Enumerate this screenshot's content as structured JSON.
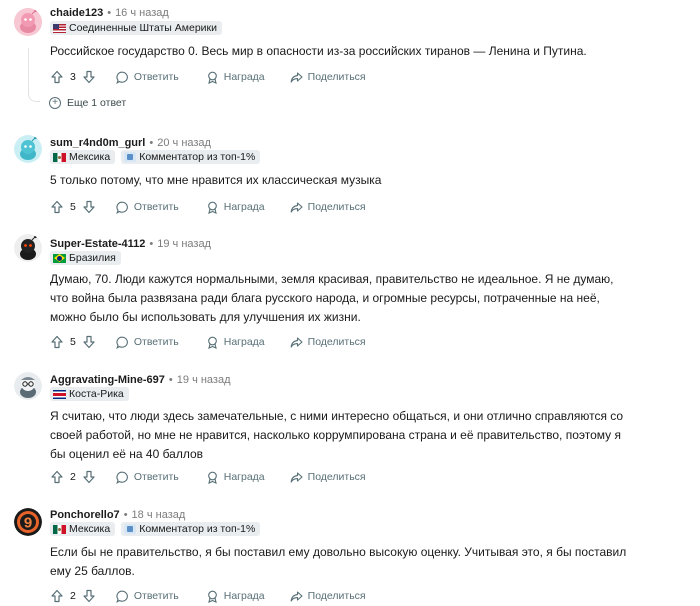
{
  "actions": {
    "reply": "Ответить",
    "award": "Награда",
    "share": "Поделиться"
  },
  "comments": [
    {
      "author": "chaide123",
      "time": "16 ч назад",
      "avatar": "pink-alien-avatar",
      "flairs": [
        {
          "icon": "flag-us-icon",
          "text": "Соединенные Штаты Америки"
        }
      ],
      "body": "Российское государство 0. Весь мир в опасности из-за российских тиранов — Ленина и Путина.",
      "votes": "3",
      "more_replies": "Еще 1 ответ"
    },
    {
      "author": "sum_r4nd0m_gurl",
      "time": "20 ч назад",
      "avatar": "teal-alien-avatar",
      "flairs": [
        {
          "icon": "flag-mx-icon",
          "text": "Мексика"
        },
        {
          "icon": "top-commenter-badge-icon",
          "text": "Комментатор из топ-1%"
        }
      ],
      "body": "5 только потому, что мне нравится их классическая музыка",
      "votes": "5"
    },
    {
      "author": "Super-Estate-4112",
      "time": "19 ч назад",
      "avatar": "black-alien-avatar",
      "flairs": [
        {
          "icon": "flag-br-icon",
          "text": "Бразилия"
        }
      ],
      "body": "Думаю, 70. Люди кажутся нормальными, земля красивая, правительство не идеальное. Я не думаю, что война была развязана ради блага русского народа, и огромные ресурсы, потраченные на неё, можно было бы использовать для улучшения их жизни.",
      "votes": "5"
    },
    {
      "author": "Aggravating-Mine-697",
      "time": "19 ч назад",
      "avatar": "alien-with-glasses-avatar",
      "flairs": [
        {
          "icon": "flag-cr-icon",
          "text": "Коста-Рика"
        }
      ],
      "body": "Я считаю, что люди здесь замечательные, с ними интересно общаться, и они отлично справляются со своей работой, но мне не нравится, насколько коррумпирована страна и её правительство, поэтому я бы оценил её на 40 баллов",
      "votes": "2"
    },
    {
      "author": "Ponchorello7",
      "time": "18 ч назад",
      "avatar": "orange-nine-avatar",
      "flairs": [
        {
          "icon": "flag-mx-icon",
          "text": "Мексика"
        },
        {
          "icon": "top-commenter-badge-icon",
          "text": "Комментатор из топ-1%"
        }
      ],
      "body": "Если бы не правительство, я бы поставил ему довольно высокую оценку. Учитывая это, я бы поставил ему 25 баллов.",
      "votes": "2"
    }
  ]
}
